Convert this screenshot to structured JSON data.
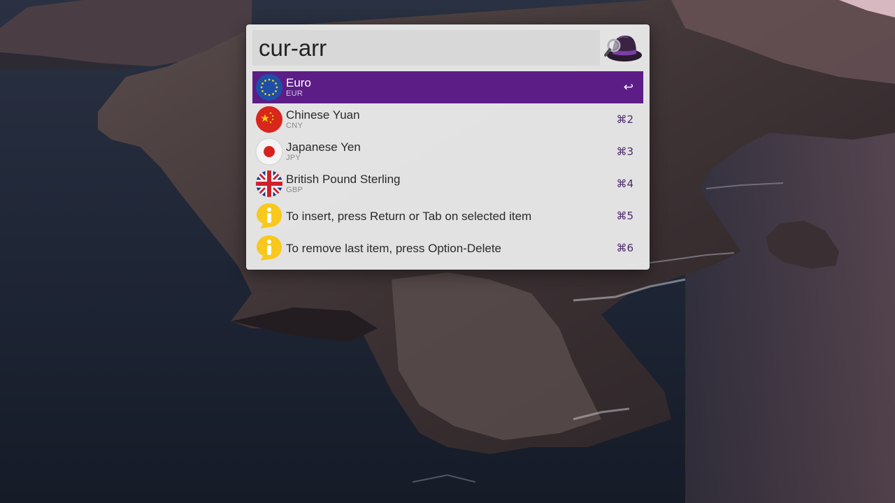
{
  "search": {
    "query": "cur-arr"
  },
  "results": [
    {
      "title": "Euro",
      "subtitle": "EUR",
      "shortcut": "↩",
      "icon": "eu-flag-icon",
      "selected": true
    },
    {
      "title": "Chinese Yuan",
      "subtitle": "CNY",
      "shortcut": "⌘2",
      "icon": "china-flag-icon",
      "selected": false
    },
    {
      "title": "Japanese Yen",
      "subtitle": "JPY",
      "shortcut": "⌘3",
      "icon": "japan-flag-icon",
      "selected": false
    },
    {
      "title": "British Pound Sterling",
      "subtitle": "GBP",
      "shortcut": "⌘4",
      "icon": "uk-flag-icon",
      "selected": false
    },
    {
      "title": "To insert, press Return or Tab on selected item",
      "subtitle": "",
      "shortcut": "⌘5",
      "icon": "info-bubble-icon",
      "selected": false
    },
    {
      "title": "To remove last item, press Option-Delete",
      "subtitle": "",
      "shortcut": "⌘6",
      "icon": "info-bubble-icon",
      "selected": false
    }
  ],
  "colors": {
    "selection": "#5c1e86",
    "panel": "#e8e8e8",
    "shortcut": "#4a2a6a"
  }
}
